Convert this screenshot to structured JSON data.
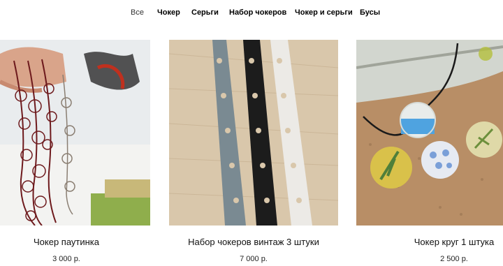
{
  "nav": {
    "items": [
      "Все",
      "Чокер",
      "Серьги",
      "Набор чокеров",
      "Чокер и серьги",
      "Бусы"
    ]
  },
  "products": [
    {
      "name": "Чокер паутинка",
      "price": "3 000 р."
    },
    {
      "name": "Набор чокеров винтаж 3 штуки",
      "price": "7 000 р."
    },
    {
      "name": "Чокер круг 1 штука",
      "price": "2 500 р."
    }
  ],
  "colors": {
    "accent": "#000000",
    "background": "#ffffff"
  }
}
